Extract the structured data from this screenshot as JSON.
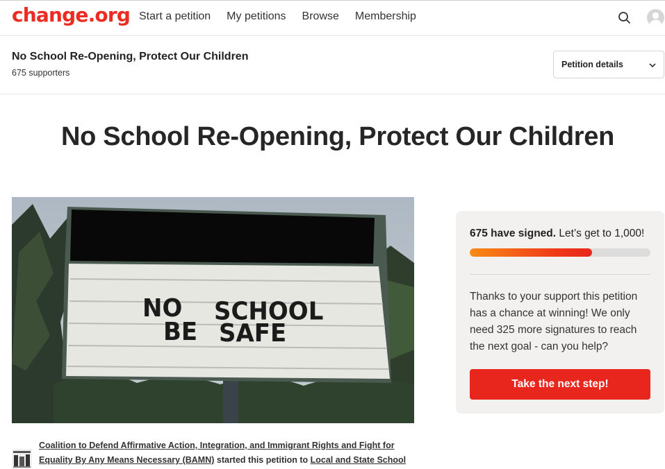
{
  "nav": {
    "logo": "change.org",
    "links": [
      "Start a petition",
      "My petitions",
      "Browse",
      "Membership"
    ]
  },
  "subbar": {
    "title": "No School Re-Opening, Protect Our Children",
    "supporters": "675 supporters",
    "details_button": "Petition details"
  },
  "headline": "No School Re-Opening, Protect Our Children",
  "hero": {
    "sign_line1_left": "NO",
    "sign_line1_right": "SCHOOL",
    "sign_line2_left": "BE",
    "sign_line2_right": "SAFE"
  },
  "panel": {
    "signed_bold": "675 have signed.",
    "signed_rest": " Let’s get to 1,000!",
    "progress": 0.675,
    "support_text": "Thanks to your support this petition has a chance at winning! We only need 325 more signatures to reach the next goal - can you help?",
    "cta": "Take the next step!"
  },
  "starter": {
    "org": "Coalition to Defend Affirmative Action, Integration, and Immigrant Rights and Fight for Equality By Any Means Necessary (BAMN)",
    "middle": " started this petition to ",
    "target": "Local and State School"
  },
  "colors": {
    "brand": "#ec2c22",
    "cta": "#e8261e",
    "progress_start": "#f98b16",
    "progress_end": "#e8261d"
  },
  "icons": [
    "search-icon",
    "avatar-icon",
    "chevron-down-icon"
  ]
}
